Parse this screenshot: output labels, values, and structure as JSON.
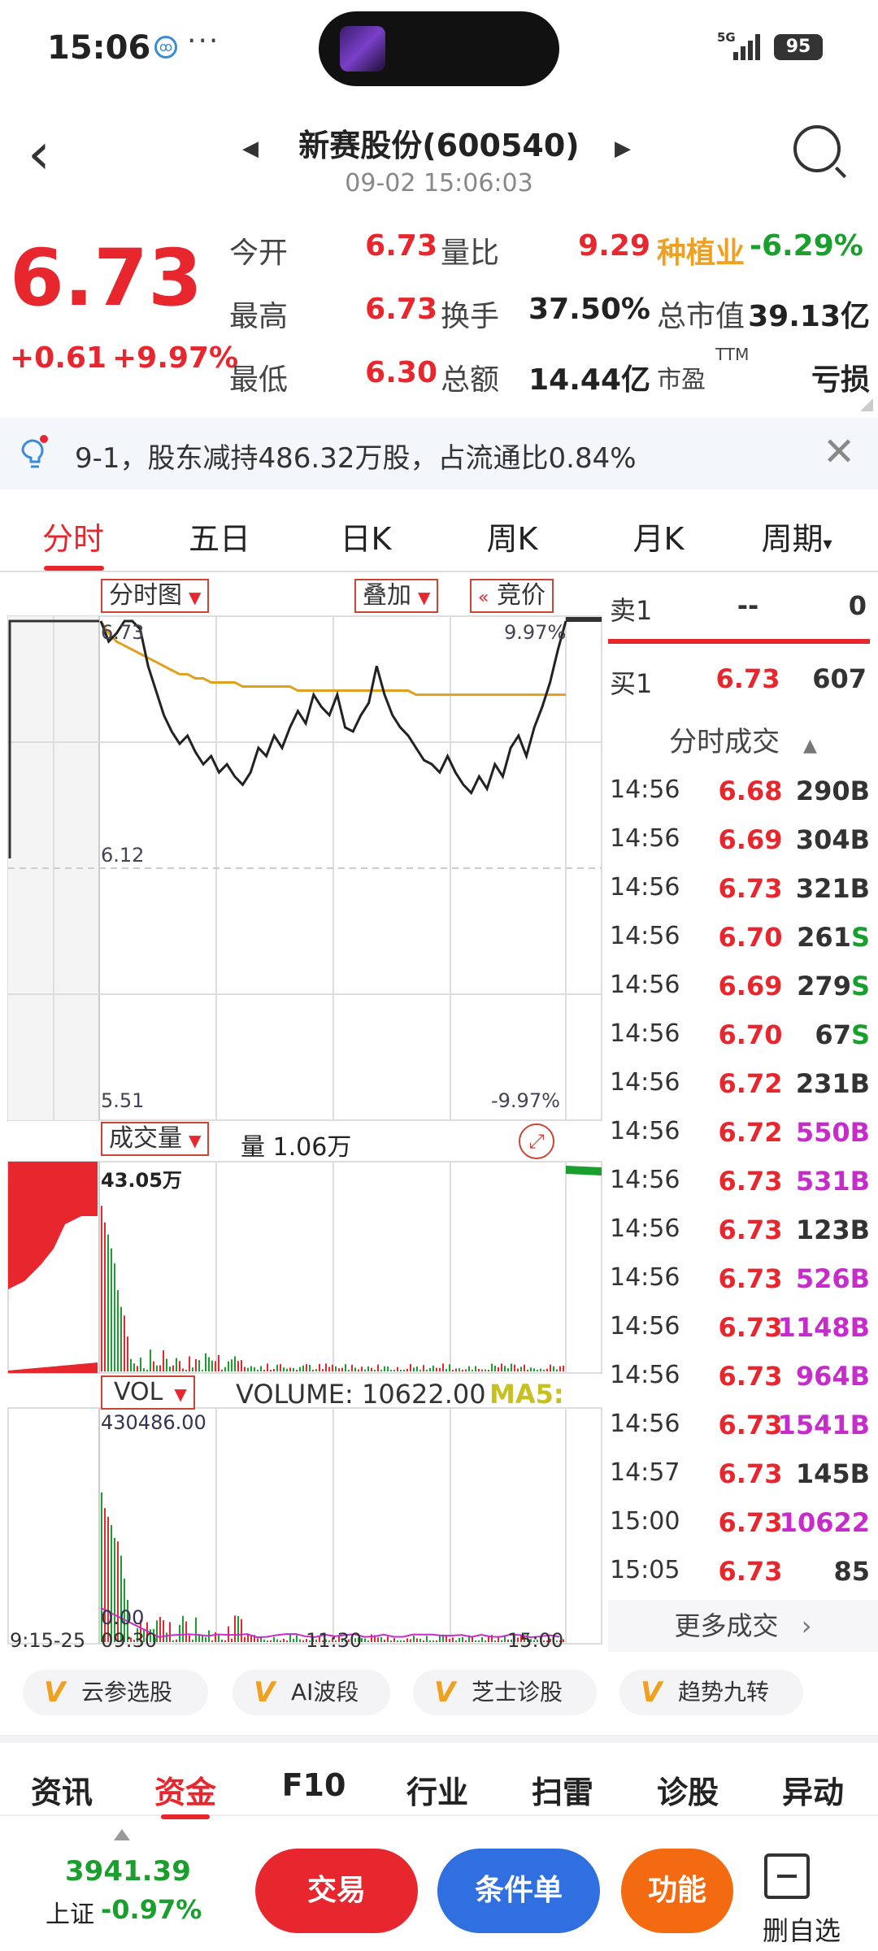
{
  "status": {
    "time": "15:06",
    "dots": "···",
    "net": "5G",
    "battery": "95"
  },
  "header": {
    "title": "新赛股份(600540)",
    "subtitle": "09-02 15:06:03"
  },
  "quote": {
    "price": "6.73",
    "change": "+0.61",
    "change_pct": "+9.97%",
    "rows": [
      [
        {
          "label": "今开",
          "value": "6.73",
          "color": "red"
        },
        {
          "label": "量比",
          "value": "9.29",
          "color": "red"
        }
      ],
      [
        {
          "label": "最高",
          "value": "6.73",
          "color": "red"
        },
        {
          "label": "换手",
          "value": "37.50%",
          "color": "dark"
        }
      ],
      [
        {
          "label": "最低",
          "value": "6.30",
          "color": "red"
        },
        {
          "label": "总额",
          "value": "14.44亿",
          "color": "dark"
        }
      ]
    ],
    "industry": "种植业",
    "industry_pct": "-6.29%",
    "mktcap_label": "总市值",
    "mktcap_value": "39.13亿",
    "pe_label": "市盈",
    "pe_sup": "TTM",
    "pe_value": "亏损"
  },
  "notice": {
    "text": "9-1，股东减持486.32万股，占流通比0.84%"
  },
  "tabs": [
    "分时",
    "五日",
    "日K",
    "周K",
    "月K",
    "周期"
  ],
  "chart": {
    "dropdown_main": "分时图",
    "overlay": "叠加",
    "auction": "竞价",
    "y_top": "6.73",
    "y_mid": "6.12",
    "y_bot": "5.51",
    "pct_top": "9.97%",
    "pct_bot": "-9.97%",
    "vol_dropdown": "成交量",
    "vol_text": "量 1.06万",
    "vol_max": "43.05万",
    "vol2_dropdown": "VOL",
    "volume_label": "VOLUME: 10622.00",
    "ma5_label": "MA5:",
    "vol2_max": "430486.00",
    "vol2_zero": "0.00",
    "x_labels": [
      "9:15-25",
      "09:30",
      "11:30",
      "15:00"
    ]
  },
  "chart_data": {
    "type": "line",
    "title": "",
    "ylim": [
      5.51,
      6.73
    ],
    "price": [
      6.73,
      6.68,
      6.7,
      6.73,
      6.73,
      6.71,
      6.62,
      6.56,
      6.5,
      6.46,
      6.43,
      6.45,
      6.41,
      6.38,
      6.4,
      6.36,
      6.38,
      6.35,
      6.33,
      6.36,
      6.42,
      6.4,
      6.45,
      6.42,
      6.47,
      6.51,
      6.48,
      6.55,
      6.52,
      6.5,
      6.55,
      6.47,
      6.46,
      6.5,
      6.53,
      6.62,
      6.55,
      6.5,
      6.47,
      6.45,
      6.42,
      6.39,
      6.38,
      6.36,
      6.4,
      6.36,
      6.33,
      6.31,
      6.35,
      6.32,
      6.38,
      6.35,
      6.42,
      6.45,
      6.4,
      6.47,
      6.52,
      6.58,
      6.66,
      6.73
    ],
    "avg": [
      6.73,
      6.7,
      6.68,
      6.67,
      6.66,
      6.65,
      6.64,
      6.63,
      6.62,
      6.61,
      6.6,
      6.6,
      6.59,
      6.59,
      6.58,
      6.58,
      6.58,
      6.58,
      6.57,
      6.57,
      6.57,
      6.57,
      6.57,
      6.57,
      6.57,
      6.56,
      6.56,
      6.56,
      6.56,
      6.56,
      6.56,
      6.56,
      6.56,
      6.56,
      6.56,
      6.56,
      6.56,
      6.56,
      6.56,
      6.56,
      6.55,
      6.55,
      6.55,
      6.55,
      6.55,
      6.55,
      6.55,
      6.55,
      6.55,
      6.55,
      6.55,
      6.55,
      6.55,
      6.55,
      6.55,
      6.55,
      6.55,
      6.55,
      6.55,
      6.55
    ]
  },
  "orderbook": {
    "sell": {
      "label": "卖1",
      "price": "--",
      "vol": "0"
    },
    "buy": {
      "label": "买1",
      "price": "6.73",
      "vol": "607"
    },
    "trades_title": "分时成交",
    "more": "更多成交"
  },
  "ticks": [
    {
      "t": "14:56",
      "p": "6.68",
      "v": "290",
      "s": "B",
      "vc": "dark"
    },
    {
      "t": "14:56",
      "p": "6.69",
      "v": "304",
      "s": "B",
      "vc": "dark"
    },
    {
      "t": "14:56",
      "p": "6.73",
      "v": "321",
      "s": "B",
      "vc": "dark"
    },
    {
      "t": "14:56",
      "p": "6.70",
      "v": "261",
      "s": "S",
      "vc": "dark"
    },
    {
      "t": "14:56",
      "p": "6.69",
      "v": "279",
      "s": "S",
      "vc": "dark"
    },
    {
      "t": "14:56",
      "p": "6.70",
      "v": "67",
      "s": "S",
      "vc": "dark"
    },
    {
      "t": "14:56",
      "p": "6.72",
      "v": "231",
      "s": "B",
      "vc": "dark"
    },
    {
      "t": "14:56",
      "p": "6.72",
      "v": "550",
      "s": "B",
      "vc": "purple"
    },
    {
      "t": "14:56",
      "p": "6.73",
      "v": "531",
      "s": "B",
      "vc": "purple"
    },
    {
      "t": "14:56",
      "p": "6.73",
      "v": "123",
      "s": "B",
      "vc": "dark"
    },
    {
      "t": "14:56",
      "p": "6.73",
      "v": "526",
      "s": "B",
      "vc": "purple"
    },
    {
      "t": "14:56",
      "p": "6.73",
      "v": "1148",
      "s": "B",
      "vc": "purple"
    },
    {
      "t": "14:56",
      "p": "6.73",
      "v": "964",
      "s": "B",
      "vc": "purple"
    },
    {
      "t": "14:56",
      "p": "6.73",
      "v": "1541",
      "s": "B",
      "vc": "purple"
    },
    {
      "t": "14:57",
      "p": "6.73",
      "v": "145",
      "s": "B",
      "vc": "dark"
    },
    {
      "t": "15:00",
      "p": "6.73",
      "v": "10622",
      "s": "",
      "vc": "purple"
    },
    {
      "t": "15:05",
      "p": "6.73",
      "v": "85",
      "s": "",
      "vc": "dark"
    }
  ],
  "vchips": [
    "云参选股",
    "AI波段",
    "芝士诊股",
    "趋势九转"
  ],
  "vchip_mark": "V",
  "bottom_tabs": [
    "资讯",
    "资金",
    "F10",
    "行业",
    "扫雷",
    "诊股",
    "异动"
  ],
  "index": {
    "value": "3941.39",
    "name": "上证",
    "pct": "-0.97%"
  },
  "actions": {
    "trade": "交易",
    "cond": "条件单",
    "func": "功能",
    "del": "删自选"
  },
  "colors": {
    "red": "#e8262e",
    "green": "#1a9e2e",
    "purple": "#c62cc9",
    "orange": "#f0a020",
    "blue": "#2f6fe0"
  }
}
